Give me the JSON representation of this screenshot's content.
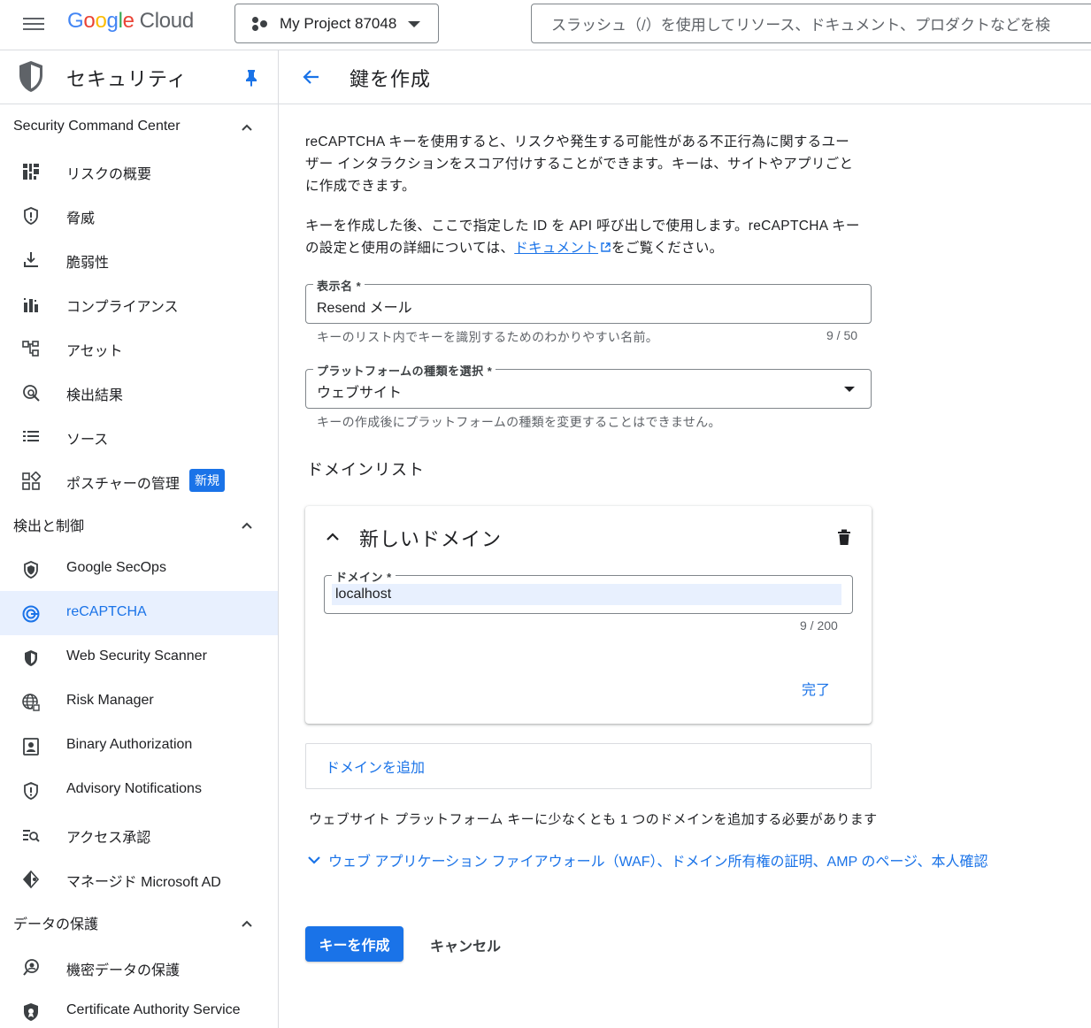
{
  "topbar": {
    "logo_letters": [
      "G",
      "o",
      "o",
      "g",
      "l",
      "e"
    ],
    "logo_cloud": "Cloud",
    "project_name": "My Project 87048",
    "search_placeholder": "スラッシュ（/）を使用してリソース、ドキュメント、プロダクトなどを検"
  },
  "sidebar": {
    "title": "セキュリティ",
    "sections": [
      {
        "label": "Security Command Center",
        "items": [
          {
            "label": "リスクの概要",
            "icon": "dashboard-icon"
          },
          {
            "label": "脅威",
            "icon": "shield-alert-icon"
          },
          {
            "label": "脆弱性",
            "icon": "vulnerability-icon"
          },
          {
            "label": "コンプライアンス",
            "icon": "bar-chart-icon"
          },
          {
            "label": "アセット",
            "icon": "asset-hierarchy-icon"
          },
          {
            "label": "検出結果",
            "icon": "search-findings-icon"
          },
          {
            "label": "ソース",
            "icon": "list-icon"
          },
          {
            "label": "ポスチャーの管理",
            "icon": "grid-icon",
            "badge": "新規"
          }
        ]
      },
      {
        "label": "検出と制御",
        "items": [
          {
            "label": "Google SecOps",
            "icon": "secops-shield-icon"
          },
          {
            "label": "reCAPTCHA",
            "icon": "recaptcha-icon",
            "active": true
          },
          {
            "label": "Web Security Scanner",
            "icon": "scanner-shield-icon"
          },
          {
            "label": "Risk Manager",
            "icon": "globe-icon"
          },
          {
            "label": "Binary Authorization",
            "icon": "badge-person-icon"
          },
          {
            "label": "Advisory Notifications",
            "icon": "notification-shield-icon"
          },
          {
            "label": "アクセス承認",
            "icon": "access-search-icon"
          },
          {
            "label": "マネージド Microsoft AD",
            "icon": "managed-ad-icon"
          }
        ]
      },
      {
        "label": "データの保護",
        "items": [
          {
            "label": "機密データの保護",
            "icon": "sensitive-data-icon"
          },
          {
            "label": "Certificate Authority Service",
            "icon": "certificate-icon"
          }
        ]
      }
    ]
  },
  "main": {
    "title": "鍵を作成",
    "intro_line1": "reCAPTCHA キーを使用すると、リスクや発生する可能性がある不正行為に関するユー",
    "intro_line2": "ザー インタラクションをスコア付けすることができます。キーは、サイトやアプリごと",
    "intro_line3": "に作成できます。",
    "info_line1": "キーを作成した後、ここで指定した ID を API 呼び出しで使用します。reCAPTCHA キー",
    "info_line2_pre": "の設定と使用の詳細については、",
    "info_link": "ドキュメント",
    "info_line2_post": "をご覧ください。",
    "display_name": {
      "label": "表示名 *",
      "value": "Resend メール",
      "hint": "キーのリスト内でキーを識別するためのわかりやすい名前。",
      "counter": "9 / 50"
    },
    "platform": {
      "label": "プラットフォームの種類を選択 *",
      "value": "ウェブサイト",
      "hint": "キーの作成後にプラットフォームの種類を変更することはできません。"
    },
    "domain_list_title": "ドメインリスト",
    "domain_card": {
      "title": "新しいドメイン",
      "field_label": "ドメイン *",
      "field_value": "localhost",
      "counter": "9 / 200",
      "done": "完了"
    },
    "add_domain": "ドメインを追加",
    "domain_note": "ウェブサイト プラットフォーム キーに少なくとも 1 つのドメインを追加する必要があります",
    "advanced_options": "ウェブ アプリケーション ファイアウォール（WAF）、ドメイン所有権の証明、AMP のページ、本人確認",
    "create_button": "キーを作成",
    "cancel_button": "キャンセル"
  },
  "colors": {
    "accent": "#1a73e8",
    "active_bg": "#e8f0fe",
    "text": "#202124",
    "muted": "#5f6368",
    "border": "#dadce0"
  }
}
